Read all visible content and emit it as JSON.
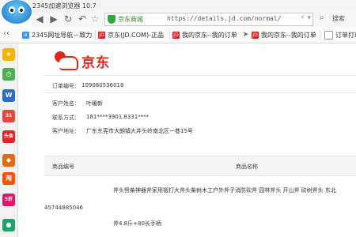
{
  "browser": {
    "title": "2345加速浏览器 10.7",
    "site_label": "京东商城",
    "url": "https://details.jd.com/normal/",
    "search_placeholder": "搜索",
    "bookmarks": [
      {
        "label": "2345网址导航－致力",
        "icon": "g2345"
      },
      {
        "label": "京东(JD.COM)-正品",
        "icon": "jd"
      },
      {
        "label": "我的京东--我的订单",
        "icon": "jd"
      },
      {
        "label": "我的京东--我的订单",
        "icon": "jd"
      },
      {
        "label": "订单打印",
        "icon": "doc"
      }
    ],
    "sidebar_icons": [
      {
        "name": "star-icon",
        "glyph": "★",
        "color": "#f5b400"
      },
      {
        "name": "clock-icon",
        "glyph": "◷",
        "color": "#4caf50"
      },
      {
        "name": "word-icon",
        "glyph": "W",
        "color": "#2b6cc4"
      },
      {
        "name": "calendar-icon",
        "glyph": "31",
        "color": "#e04a3a"
      },
      {
        "name": "toutiao-icon",
        "glyph": "头条",
        "color": "#e02424"
      },
      {
        "name": "game-icon",
        "glyph": "◆",
        "color": "#e86a10"
      },
      {
        "name": "taobao-icon",
        "glyph": "淘",
        "color": "#ff5000"
      },
      {
        "name": "tmall-icon",
        "glyph": "5折",
        "color": "#e0156a"
      },
      {
        "name": "app-icon",
        "glyph": "●",
        "color": "#1fa36b"
      }
    ]
  },
  "order": {
    "brand": "京东",
    "order_no_label": "订单编号：",
    "order_no": "109060536018",
    "customer_label": "客户姓名：",
    "customer": "叶暖新",
    "phone_label": "联系方式：",
    "phone": "181****3901,8331****",
    "address_label": "客户地址：",
    "address": "广东东莞市大朗镇大井头岭南北区一巷15号"
  },
  "table": {
    "col_product_no": "商品编号",
    "col_product_name": "商品名称",
    "row": {
      "product_no": "45744885046",
      "name_line1": "斧头劈柴神器斧家用锻打大斧头柴树木工户外斧子消防砍斧 园林斧头  开山斧  砍树斧头  东北",
      "name_line2": "斧4.8斤+80长手柄"
    }
  }
}
